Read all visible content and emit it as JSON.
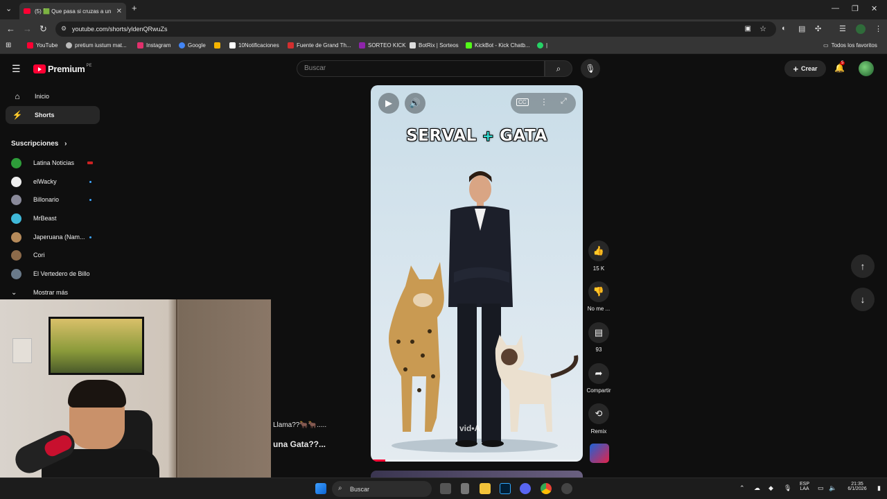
{
  "browser": {
    "tab_title": "(5) 🟩 Que pasa si cruzas a un",
    "url": "youtube.com/shorts/yldenQRwuZs",
    "bookmarks": [
      {
        "label": "YouTube",
        "color": "#ff0033"
      },
      {
        "label": "pretium iustum mat...",
        "color": "#bbbbbb"
      },
      {
        "label": "Instagram",
        "color": "#e1306c"
      },
      {
        "label": "Google",
        "color": "#4285f4"
      },
      {
        "label": "",
        "color": "#f5b400"
      },
      {
        "label": "10Notificaciones",
        "color": "#ffffff"
      },
      {
        "label": "Fuente de Grand Th...",
        "color": "#d32f2f"
      },
      {
        "label": "SORTEO KICK",
        "color": "#8e24aa"
      },
      {
        "label": "BotRix | Sorteos",
        "color": "#dddddd"
      },
      {
        "label": "KickBot - Kick Chatb...",
        "color": "#53fc18"
      },
      {
        "label": "|",
        "color": "#25d366"
      }
    ],
    "all_bookmarks": "Todos los favoritos"
  },
  "youtube": {
    "logo_text": "Premium",
    "region": "PE",
    "search_placeholder": "Buscar",
    "create_label": "Crear",
    "notif_count": "5",
    "nav": [
      {
        "label": "Inicio",
        "icon": "home-icon"
      },
      {
        "label": "Shorts",
        "icon": "shorts-icon"
      }
    ],
    "subs_heading": "Suscripciones",
    "subscriptions": [
      {
        "name": "Latina Noticias",
        "color": "#2e9d3a",
        "indicator": "live"
      },
      {
        "name": "elWacky",
        "color": "#eeeeee",
        "indicator": "dot"
      },
      {
        "name": "Billonario",
        "color": "#8a8a9a",
        "indicator": "dot"
      },
      {
        "name": "MrBeast",
        "color": "#3fb8d8",
        "indicator": "none"
      },
      {
        "name": "Japeruana (Nam...",
        "color": "#b58a5a",
        "indicator": "dot"
      },
      {
        "name": "Cori",
        "color": "#8c6a4a",
        "indicator": "none"
      },
      {
        "name": "El Vertedero de Billo",
        "color": "#6a7a8a",
        "indicator": "none"
      }
    ],
    "show_more": "Mostrar más",
    "short": {
      "title_left": "SERVAL",
      "title_plus": "+",
      "title_right": "GATA",
      "watermark": "vid•A"
    },
    "actions": {
      "likes": "15 K",
      "dislike": "No me ...",
      "comments": "93",
      "share": "Compartir",
      "remix": "Remix"
    }
  },
  "overlay": {
    "line1": "Llama??🐂🐂.....",
    "line2": "una Gata??..."
  },
  "taskbar": {
    "search": "Buscar",
    "lang_top": "ESP",
    "lang_bottom": "LAA",
    "time": "21:35",
    "date": "6/1/2026"
  }
}
